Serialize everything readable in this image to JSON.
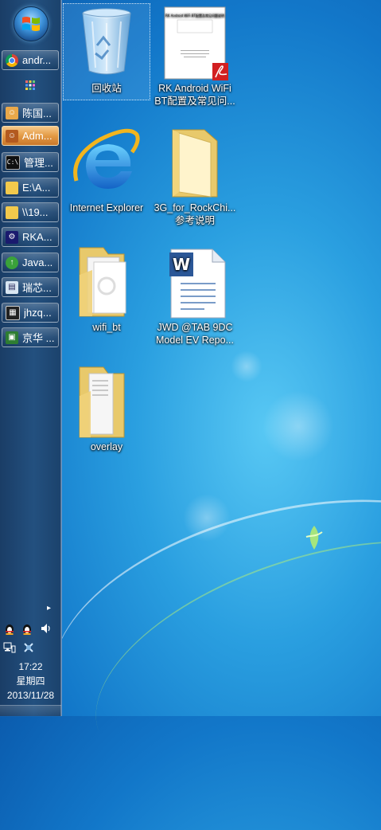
{
  "desktop": {
    "icons": [
      {
        "label": "回收站",
        "icon": "recycle-bin-icon"
      },
      {
        "label": "RK Android WiFi BT配置及常见问...",
        "icon": "pdf-document-icon",
        "doc_title": "RK Android WiFi BT配置及常见问题说明"
      },
      {
        "label": "Internet Explorer",
        "icon": "internet-explorer-icon"
      },
      {
        "label": "3G_for_RockChi... 参考说明",
        "icon": "folder-icon"
      },
      {
        "label": "wifi_bt",
        "icon": "folder-icon"
      },
      {
        "label": "JWD @TAB 9DC Model EV Repo...",
        "icon": "word-document-icon"
      },
      {
        "label": "overlay",
        "icon": "folder-icon"
      }
    ]
  },
  "taskbar": {
    "buttons": [
      {
        "label": "andr...",
        "icon": "chrome-icon",
        "active": false
      },
      {
        "label": "陈国...",
        "icon": "qq-chat-icon",
        "active": false
      },
      {
        "label": "Adm...",
        "icon": "qq-chat-icon",
        "active": true
      },
      {
        "label": "管理...",
        "icon": "command-prompt-icon",
        "active": false
      },
      {
        "label": "E:\\A...",
        "icon": "folder-icon",
        "active": false
      },
      {
        "label": "\\\\19...",
        "icon": "folder-icon",
        "active": false
      },
      {
        "label": "RKA...",
        "icon": "rk-tool-icon",
        "active": false
      },
      {
        "label": "Java...",
        "icon": "java-icon",
        "active": false
      },
      {
        "label": "瑞芯...",
        "icon": "app-icon",
        "active": false
      },
      {
        "label": "jhzq...",
        "icon": "terminal-icon",
        "active": false
      },
      {
        "label": "京华 ...",
        "icon": "app-icon",
        "active": false
      }
    ],
    "clock": {
      "time": "17:22",
      "weekday": "星期四",
      "date": "2013/11/28"
    }
  },
  "colors": {
    "taskbar": "#23507f",
    "active_button": "#e39a45",
    "desktop": "#1e8bd6"
  }
}
